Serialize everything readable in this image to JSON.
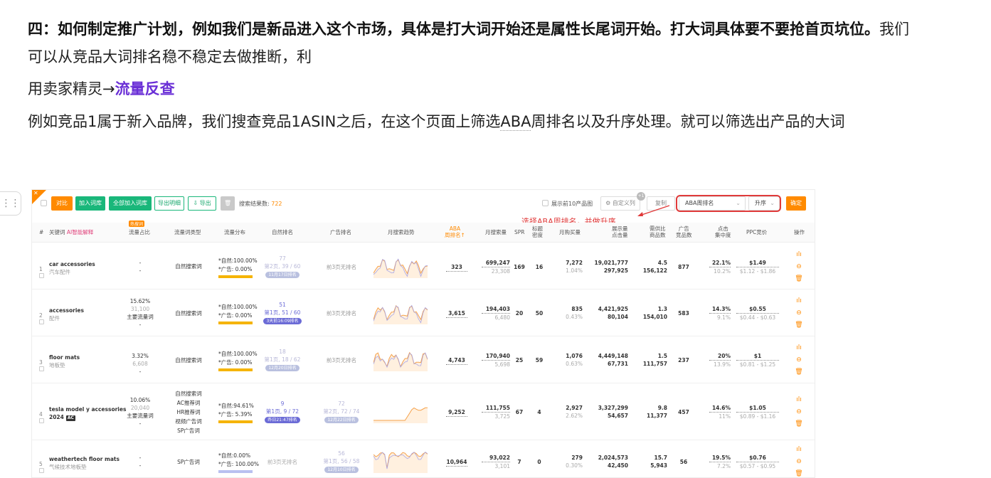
{
  "article": {
    "p1_bold": "四：如何制定推广计划，例如我们是新品进入这个市场，具体是打大词开始还是属性长尾词开始。打大词具体要不要抢首页坑位。",
    "p1_rest": "我们可以从竞品大词排名稳不稳定去做推断，利",
    "p2_prefix": "用卖家精灵→",
    "p2_link": "流量反查",
    "p3_a": "例如竞品1属于新入品牌，我们搜查竞品1ASIN之后，在这个页面上筛选",
    "p3_aba": "ABA",
    "p3_b": "周排名以及升序处理。就可以筛选出产品的大词"
  },
  "drag_handle": "⋮⋮",
  "toolbar": {
    "btn_compare": "对比",
    "btn_add_lexicon": "加入词库",
    "btn_add_all": "全部加入词库",
    "btn_export_detail": "导出明细",
    "btn_export": "⇩ 导出",
    "btn_delete": "🗑",
    "result_label": "搜索结果数:",
    "result_count": "722",
    "show_top10": "展示前10产品图",
    "custom_columns": "⚙ 自定义列",
    "custom_badge": "+1",
    "copy": "复制",
    "sort_field": "ABA周排名",
    "sort_order": "升序",
    "confirm": "确定"
  },
  "annotation": "选择ABA周排名，并做升序",
  "header": {
    "idx": "#",
    "keyword": "关键词",
    "keyword_tag": "AI智能解释",
    "hot": "热搜词",
    "traffic_share": "流量占比",
    "traffic_type": "流量词类型",
    "traffic_dist": "流量分布",
    "organic_rank": "自然排名",
    "ad_rank": "广告排名",
    "trend": "月搜索趋势",
    "aba": "ABA\n周排名↑",
    "monthly_search": "月搜索量",
    "spr": "SPR",
    "title_density": "标题\n密度",
    "monthly_buy": "月购买量",
    "impressions": "展示量\n点击量",
    "supply_ratio": "需供比\n商品数",
    "ad_products": "广告\n竞品数",
    "click_conc": "点击\n集中度",
    "ppc": "PPC竞价",
    "ops": "操作"
  },
  "rows": [
    {
      "n": "1",
      "kw": "car accessories",
      "kw_cn": "汽车配件",
      "share": "-",
      "share2": "",
      "share3": "-",
      "share4": "",
      "type": [
        "自然搜索词"
      ],
      "org_label": "*自然:",
      "org_pct": "100.00%",
      "ad_label": "*广告:",
      "ad_pct": "0.00%",
      "rank_top": "77",
      "rank_mid": "第2页, 39 / 60",
      "rank_pill": "11月17日排名",
      "ad_rank": "前3页无排名",
      "ad_rank2": "",
      "ad_pill": "",
      "aba": "323",
      "search": "699,247",
      "search2": "23,308",
      "spr": "169",
      "density": "16",
      "buy": "7,272",
      "buy2": "1.04%",
      "imp": "19,021,777",
      "imp2": "297,925",
      "supply": "4.5",
      "supply2": "156,122",
      "adprod": "877",
      "click": "22.1%",
      "click2": "10.2%",
      "ppc": "$1.49",
      "ppc2": "$1.12 - $1.86"
    },
    {
      "n": "2",
      "kw": "accessories",
      "kw_cn": "配件",
      "share": "15.62%",
      "share2": "31,100",
      "share3": "主要流量词",
      "share4": "-",
      "type": [
        "自然搜索词"
      ],
      "org_label": "*自然:",
      "org_pct": "100.00%",
      "ad_label": "*广告:",
      "ad_pct": "0.00%",
      "rank_top": "51",
      "rank_mid": "第1页, 51 / 60",
      "rank_pill": "3天前16:09排名",
      "ad_rank": "前3页无排名",
      "ad_rank2": "",
      "ad_pill": "",
      "aba": "3,615",
      "search": "194,403",
      "search2": "6,480",
      "spr": "20",
      "density": "50",
      "buy": "835",
      "buy2": "0.43%",
      "imp": "4,421,925",
      "imp2": "80,104",
      "supply": "1.3",
      "supply2": "154,010",
      "adprod": "583",
      "click": "14.3%",
      "click2": "9.1%",
      "ppc": "$0.55",
      "ppc2": "$0.44 - $0.63"
    },
    {
      "n": "3",
      "kw": "floor mats",
      "kw_cn": "地板垫",
      "share": "3.32%",
      "share2": "6,608",
      "share3": "-",
      "share4": "",
      "type": [
        "自然搜索词"
      ],
      "org_label": "*自然:",
      "org_pct": "100.00%",
      "ad_label": "*广告:",
      "ad_pct": "0.00%",
      "rank_top": "18",
      "rank_mid": "第1页, 18 / 62",
      "rank_pill": "12月20日排名",
      "ad_rank": "前3页无排名",
      "ad_rank2": "",
      "ad_pill": "",
      "aba": "4,743",
      "search": "170,940",
      "search2": "5,698",
      "spr": "25",
      "density": "59",
      "buy": "1,076",
      "buy2": "0.63%",
      "imp": "4,449,148",
      "imp2": "67,731",
      "supply": "1.5",
      "supply2": "111,757",
      "adprod": "237",
      "click": "20%",
      "click2": "13.9%",
      "ppc": "$1",
      "ppc2": "$0.81 - $1.25"
    },
    {
      "n": "4",
      "kw": "tesla model y accessories",
      "kw_cn": "2024",
      "share": "10.06%",
      "share2": "20,040",
      "share3": "主要流量词",
      "share4": "-",
      "type": [
        "自然搜索词",
        "AC推荐词",
        "HR推荐词",
        "视频广告词",
        "SP广告词"
      ],
      "org_label": "*自然:",
      "org_pct": "94.61%",
      "ad_label": "*广告:",
      "ad_pct": "5.39%",
      "rank_top": "9",
      "rank_mid": "第1页, 9 / 72",
      "rank_pill": "昨日21:47排名",
      "ad_rank": "72",
      "ad_rank2": "第2页, 72 / 74",
      "ad_pill": "12月22日排名",
      "aba": "9,252",
      "search": "111,755",
      "search2": "3,725",
      "spr": "67",
      "density": "4",
      "buy": "2,927",
      "buy2": "2.62%",
      "imp": "3,327,299",
      "imp2": "54,657",
      "supply": "9.8",
      "supply2": "11,377",
      "adprod": "457",
      "click": "14.6%",
      "click2": "11%",
      "ppc": "$1.05",
      "ppc2": "$0.89 - $1.16"
    },
    {
      "n": "5",
      "kw": "weathertech floor mats",
      "kw_cn": "气候技术地板垫",
      "share": "-",
      "share2": "",
      "share3": "-",
      "share4": "",
      "type": [
        "SP广告词"
      ],
      "org_label": "*自然:",
      "org_pct": "0.00%",
      "ad_label": "*广告:",
      "ad_pct": "100.00%",
      "rank_top": "",
      "rank_mid": "前3页无排名",
      "rank_pill": "",
      "ad_rank": "56",
      "ad_rank2": "第1页, 56 / 58",
      "ad_pill": "12月10日排名",
      "aba": "10,964",
      "search": "93,022",
      "search2": "3,101",
      "spr": "7",
      "density": "0",
      "buy": "279",
      "buy2": "0.30%",
      "imp": "2,024,573",
      "imp2": "42,450",
      "supply": "15.7",
      "supply2": "5,943",
      "adprod": "56",
      "click": "19.5%",
      "click2": "7.2%",
      "ppc": "$0.76",
      "ppc2": "$0.57 - $0.95"
    }
  ],
  "icons": {
    "chart": "chart-icon",
    "minus": "minus-circle-icon",
    "delete": "trash-icon"
  }
}
